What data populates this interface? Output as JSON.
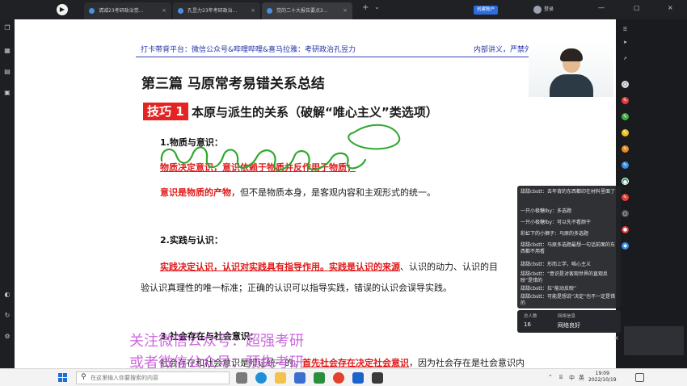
{
  "tabs": [
    {
      "label": "请减23考研政治觉...",
      "close": "×"
    },
    {
      "label": "孔昱力23年考研政治...",
      "close": "×"
    },
    {
      "label": "党的二十大报告要点2...",
      "close": "×"
    }
  ],
  "tab_new": "+",
  "tab_more": "⌄",
  "account_button": "创建账户",
  "login": "登录",
  "window_controls": {
    "minimize": "—",
    "restore": "▢",
    "close": "×"
  },
  "slide": {
    "header_left": "打卡带背平台：微信公众号&哔哩哔哩&喜马拉雅：考研政治孔昱力",
    "header_right": "内部讲义，严禁外传",
    "title": "第三篇  马原常考易错关系总结",
    "skill_badge": "技巧 1",
    "skill_title": "本原与派生的关系（破解“唯心主义”类选项）",
    "section1": {
      "heading": "1.物质与意识：",
      "line1": "物质决定意识，意识依赖于物质并反作用于物质；",
      "line2_red": "意识是物质的产物",
      "line2_rest": "，但不是物质本身，是客观内容和主观形式的统一。"
    },
    "section2": {
      "heading": "2.实践与认识：",
      "line1_red": "实践决定认识，认识对实践具有指导作用。实践是认识的来源",
      "line1_rest": "、认识的动力、认识的目",
      "line2": "验认识真理性的唯一标准；正确的认识可以指导实践，错误的认识会误导实践。"
    },
    "section3": {
      "heading": "3.社会存在与社会意识：",
      "line1_a": "社会存在和社会意识是辩证统一的。",
      "line1_red": "首先社会存在决定社会意识",
      "line1_rest": "，因为社会存在是社会意识内"
    }
  },
  "chat": {
    "messages": [
      {
        "user": "甜甜cbstt：",
        "text": "去年背的东西都印在材料里面了"
      },
      {
        "user": "一只小极糖lby：",
        "text": "多选题"
      },
      {
        "user": "一只小极糖lby：",
        "text": "可以先不看颜干"
      },
      {
        "user": "彩虹下的小狮子：",
        "text": "马原的多选题"
      },
      {
        "user": "甜甜cbstt：",
        "text": "马原多选题最想一句话前面的东西都不用看"
      },
      {
        "user": "甜甜cbstt：",
        "text": "形而上学，唯心主义"
      },
      {
        "user": "甜甜cbstt：",
        "text": "“意识是对客观世界的直观反映”是错的"
      },
      {
        "user": "甜甜cbstt：",
        "text": "拉“能动反映”"
      },
      {
        "user": "甜甜cbstt：",
        "text": "可能是想说“决定”也不一定是错的"
      }
    ],
    "stats": {
      "online_label": "总人数",
      "online_value": "16",
      "network_label": "网络信息",
      "network_value": "网络良好"
    },
    "close": "×"
  },
  "watermark": {
    "line1": "关注微信公众号：超强考研",
    "line2": "或者微信公众号：预失考研"
  },
  "taskbar": {
    "search_placeholder": "在这里输入你要搜索的内容",
    "time": "19:09",
    "date": "2022/10/19",
    "ime": "中",
    "lang": "英"
  },
  "colors": {
    "accent_red": "#e01b1b",
    "header_blue": "#2433a8",
    "pen_green": "#2ea82e",
    "watermark": "#c44fd8"
  }
}
